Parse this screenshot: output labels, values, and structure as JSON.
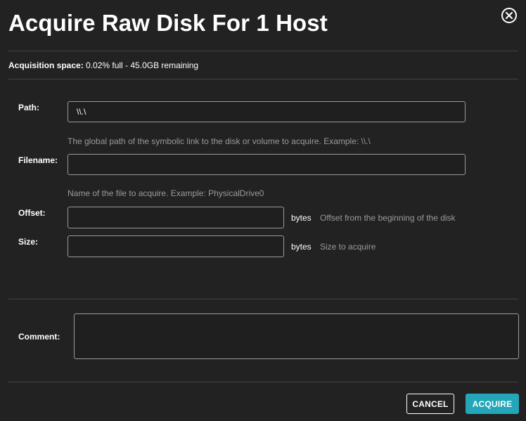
{
  "dialog": {
    "title": "Acquire Raw Disk For 1 Host",
    "close_icon": "close-circle-icon"
  },
  "acquisition": {
    "label": "Acquisition space:",
    "value": " 0.02% full - 45.0GB remaining"
  },
  "form": {
    "path": {
      "label": "Path:",
      "value": "\\\\.\\",
      "help": "The global path of the symbolic link to the disk or volume to acquire. Example: \\\\.\\"
    },
    "filename": {
      "label": "Filename:",
      "value": "",
      "help": "Name of the file to acquire. Example: PhysicalDrive0"
    },
    "offset": {
      "label": "Offset:",
      "value": "",
      "unit": "bytes",
      "help": "Offset from the beginning of the disk"
    },
    "size": {
      "label": "Size:",
      "value": "",
      "unit": "bytes",
      "help": "Size to acquire"
    },
    "comment": {
      "label": "Comment:",
      "value": ""
    }
  },
  "actions": {
    "cancel_label": "CANCEL",
    "acquire_label": "ACQUIRE"
  },
  "colors": {
    "background": "#222222",
    "accent": "#23a6b8",
    "help_text": "#9a9a9a"
  }
}
